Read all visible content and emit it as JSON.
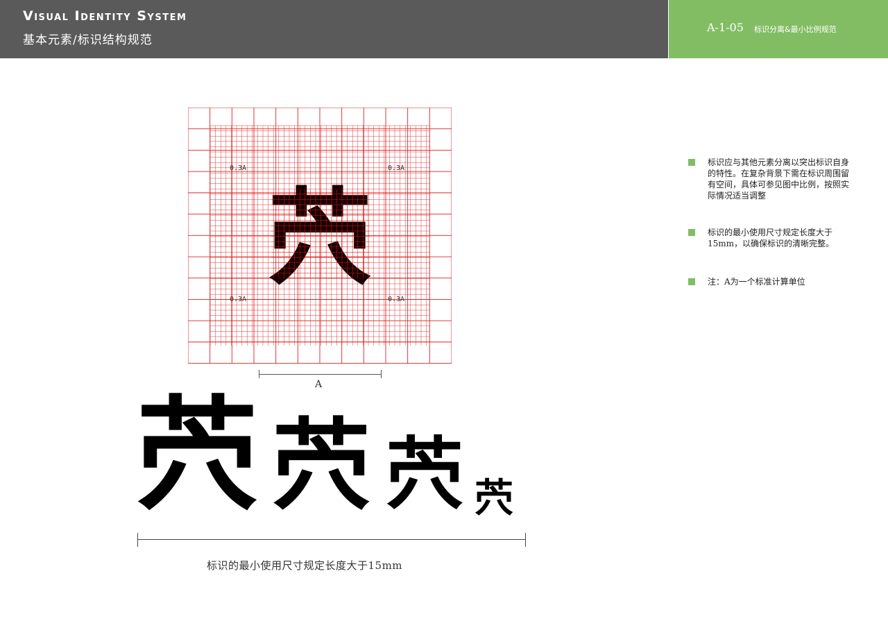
{
  "header": {
    "title": "Visual Identity System",
    "subtitle": "基本元素/标识结构规范"
  },
  "code_box": {
    "code": "A-1-05",
    "title": "标识分离&最小比例规范"
  },
  "colors": {
    "header_bg": "#5a5a5a",
    "accent_green": "#82bd64",
    "grid_red": "#e02020"
  },
  "grid": {
    "logo_glyph": "茓",
    "corner_labels": [
      "0.3A",
      "0.3A",
      "0.3A",
      "0.3A"
    ],
    "dimension_label": "A"
  },
  "logo_samples": [
    "茓",
    "茓",
    "茓",
    "茓"
  ],
  "min_size_text": "标识的最小使用尺寸规定长度大于15mm",
  "notes": [
    "标识应与其他元素分离以突出标识自身的特性。在复杂背景下需在标识周围留有空间，具体可参见图中比例，按照实际情况适当调整",
    "标识的最小使用尺寸规定长度大于15mm，以确保标识的清晰完整。",
    "注：A为一个标准计算单位"
  ]
}
